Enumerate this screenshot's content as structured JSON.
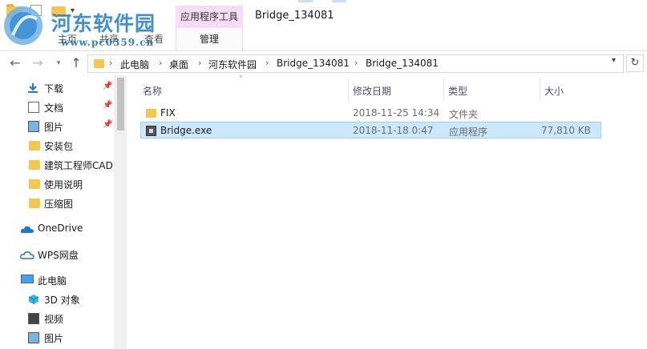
{
  "ribbon": {
    "tab_home": "主页",
    "tab_share": "共享",
    "tab_view": "查看",
    "context_group": "应用程序工具",
    "context_tab": "管理"
  },
  "window": {
    "title": "Bridge_134081"
  },
  "watermark": {
    "site_name": "河东软件园",
    "url": "www.pc0359.cn"
  },
  "address": {
    "breadcrumb": [
      "此电脑",
      "桌面",
      "河东软件园",
      "Bridge_134081",
      "Bridge_134081"
    ]
  },
  "nav_pane": {
    "items": [
      {
        "label": "下载",
        "icon": "download-icon",
        "pinned": true
      },
      {
        "label": "文档",
        "icon": "document-icon",
        "pinned": true
      },
      {
        "label": "图片",
        "icon": "pictures-icon",
        "pinned": true
      },
      {
        "label": "安装包",
        "icon": "folder-icon",
        "pinned": false
      },
      {
        "label": "建筑工程师CAD",
        "icon": "folder-icon",
        "pinned": false
      },
      {
        "label": "使用说明",
        "icon": "folder-icon",
        "pinned": false
      },
      {
        "label": "压缩图",
        "icon": "folder-icon",
        "pinned": false
      },
      {
        "label": "OneDrive",
        "icon": "onedrive-icon",
        "pinned": false
      },
      {
        "label": "WPS网盘",
        "icon": "cloud-icon",
        "pinned": false
      },
      {
        "label": "此电脑",
        "icon": "this-pc-icon",
        "pinned": false
      },
      {
        "label": "3D 对象",
        "icon": "3d-objects-icon",
        "pinned": false
      },
      {
        "label": "视频",
        "icon": "video-icon",
        "pinned": false
      },
      {
        "label": "图片",
        "icon": "pictures-icon",
        "pinned": false
      }
    ]
  },
  "file_list": {
    "columns": [
      "名称",
      "修改日期",
      "类型",
      "大小"
    ],
    "rows": [
      {
        "name": "FIX",
        "modified": "2018-11-25 14:34",
        "type": "文件夹",
        "size": "",
        "icon": "folder-icon",
        "selected": false
      },
      {
        "name": "Bridge.exe",
        "modified": "2018-11-18 0:47",
        "type": "应用程序",
        "size": "77,810 KB",
        "icon": "exe-icon",
        "selected": true
      }
    ]
  },
  "colors": {
    "selection_bg": "#cce8ff",
    "selection_border": "#99d1ff",
    "context_tab_bg": "#f6dcf6",
    "folder": "#f5c751",
    "watermark": "#2f83c9"
  }
}
